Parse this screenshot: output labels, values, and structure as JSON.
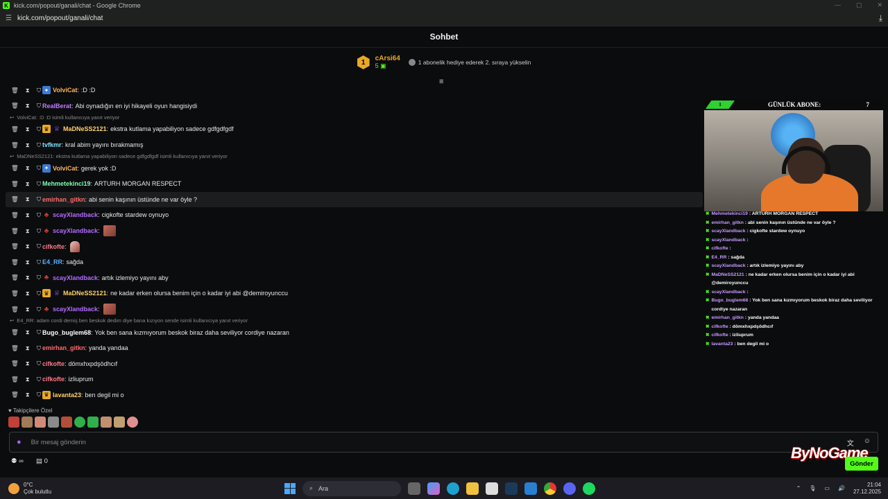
{
  "window": {
    "title": "kick.com/popout/ganali/chat - Google Chrome",
    "url": "kick.com/popout/ganali/chat"
  },
  "chat": {
    "header": "Sohbet",
    "pinned": {
      "rank": "1",
      "user": "cArsi64",
      "count": "5",
      "promo": "1 abonelik hediye ederek 2. sıraya yükselin"
    },
    "messages": [
      {
        "type": "msg",
        "user": "VolviCat",
        "color": "#ffb35c",
        "badges": [
          "blue"
        ],
        "text": ":D :D"
      },
      {
        "type": "msg",
        "user": "RealBerat",
        "color": "#c07cff",
        "badges": [],
        "text": "Abi oynadığın en iyi hikayeli oyun hangisiydi"
      },
      {
        "type": "reply",
        "text": "VolviCat: :D :D isimli kullanıcıya yanıt veriyor"
      },
      {
        "type": "msg",
        "user": "MaDNeSS2121",
        "color": "#ffd36a",
        "badges": [
          "crown",
          "purple"
        ],
        "text": "ekstra kutlama yapabiliyon sadece gdfgdfgdf"
      },
      {
        "type": "msg",
        "user": "tvfkmr",
        "color": "#7de6ff",
        "badges": [],
        "text": "kral abim yayını bırakmamış"
      },
      {
        "type": "reply",
        "text": "MaDNeSS2121: ekstra kutlama yapabiliyon sadece gdfgdfgdf isimli kullanıcıya yanıt veriyor"
      },
      {
        "type": "msg",
        "user": "VolviCat",
        "color": "#ffb35c",
        "badges": [
          "blue"
        ],
        "text": "gerek yok :D"
      },
      {
        "type": "msg",
        "user": "Mehmetekinci19",
        "color": "#7dffb0",
        "badges": [],
        "text": "ARTURH MORGAN RESPECT"
      },
      {
        "type": "msg",
        "user": "emirhan_gitkn",
        "color": "#ff6b6b",
        "badges": [],
        "text": "abi senin kaşının üstünde ne var öyle ?",
        "hl": true
      },
      {
        "type": "msg",
        "user": "scayXlandback",
        "color": "#b36bff",
        "badges": [
          "red"
        ],
        "text": "cigkofte stardew oynuyo"
      },
      {
        "type": "msg",
        "user": "scayXlandback",
        "color": "#b36bff",
        "badges": [
          "red"
        ],
        "text": "",
        "emote": "face"
      },
      {
        "type": "msg",
        "user": "cifkofte",
        "color": "#ff7a8a",
        "badges": [],
        "text": "",
        "emote": "thumb"
      },
      {
        "type": "msg",
        "user": "E4_RR",
        "color": "#5ab0ff",
        "badges": [],
        "text": "sağda"
      },
      {
        "type": "msg",
        "user": "scayXlandback",
        "color": "#b36bff",
        "badges": [
          "red"
        ],
        "text": "artık izlemiyo yayını aby"
      },
      {
        "type": "msg",
        "user": "MaDNeSS2121",
        "color": "#ffd36a",
        "badges": [
          "crown",
          "purple"
        ],
        "text": "ne kadar erken olursa benim için o kadar iyi abi @demiroyunccu"
      },
      {
        "type": "msg",
        "user": "scayXlandback",
        "color": "#b36bff",
        "badges": [
          "red"
        ],
        "text": "",
        "emote": "face"
      },
      {
        "type": "reply",
        "text": "E4_RR: adam cordi demiş ben beskok dedim diye bana kızıyon sende isimli kullanıcıya yanıt veriyor"
      },
      {
        "type": "msg",
        "user": "Bugo_buglem68",
        "color": "#ffffff",
        "badges": [],
        "text": "Yok ben sana kızmıyorum beskok biraz daha seviliyor cordiye nazaran"
      },
      {
        "type": "msg",
        "user": "emirhan_gitkn",
        "color": "#ff6b6b",
        "badges": [],
        "text": "yanda yandaa"
      },
      {
        "type": "msg",
        "user": "cifkofte",
        "color": "#ff7a8a",
        "badges": [],
        "text": "dömxhxpdşödhcıf"
      },
      {
        "type": "msg",
        "user": "cifkofte",
        "color": "#ff7a8a",
        "badges": [],
        "text": "izliuprum"
      },
      {
        "type": "msg",
        "user": "lavanta23",
        "color": "#ffd36a",
        "badges": [
          "crown"
        ],
        "text": "ben degil mi o"
      }
    ],
    "emote_label": "Takipçilere Özel",
    "input_placeholder": "Bir mesaj gönderin",
    "send_label": "Gönder",
    "bottom": {
      "gift_count": "0"
    }
  },
  "overlay": {
    "banner_tag": "1",
    "banner_title": "GÜNLÜK ABONE:",
    "banner_count": "7",
    "brand": "ByNoGame",
    "mini_chat": [
      {
        "user": "Mehmetekinci19",
        "text": "ARTURH MORGAN RESPECT"
      },
      {
        "user": "emirhan_gitkn",
        "text": "abi senin kaşının üstünde ne var öyle ?"
      },
      {
        "user": "scayXlandback",
        "text": "cigkofte stardew oynuyo"
      },
      {
        "user": "scayXlandback",
        "text": ""
      },
      {
        "user": "cifkofte",
        "text": ""
      },
      {
        "user": "E4_RR",
        "text": "sağda"
      },
      {
        "user": "scayXlandback",
        "text": "artık izlemiyo yayını aby"
      },
      {
        "user": "MaDNeSS2121",
        "text": "ne kadar erken olursa benim için o kadar iyi abi @demiroyunccu"
      },
      {
        "user": "scayXlandback",
        "text": ""
      },
      {
        "user": "Bugo_buglem68",
        "text": "Yok ben sana kızmıyorum beskok biraz daha seviliyor cordiye nazaran"
      },
      {
        "user": "emirhan_gitkn",
        "text": "yanda yandaa"
      },
      {
        "user": "cifkofte",
        "text": "dömxhxpdşödhcıf"
      },
      {
        "user": "cifkofte",
        "text": "izliuprum"
      },
      {
        "user": "lavanta23",
        "text": "ben degil mi o"
      }
    ]
  },
  "taskbar": {
    "temp": "0°C",
    "weather": "Çok bulutlu",
    "search": "Ara",
    "time": "21:04",
    "date": "27.12.2025"
  }
}
